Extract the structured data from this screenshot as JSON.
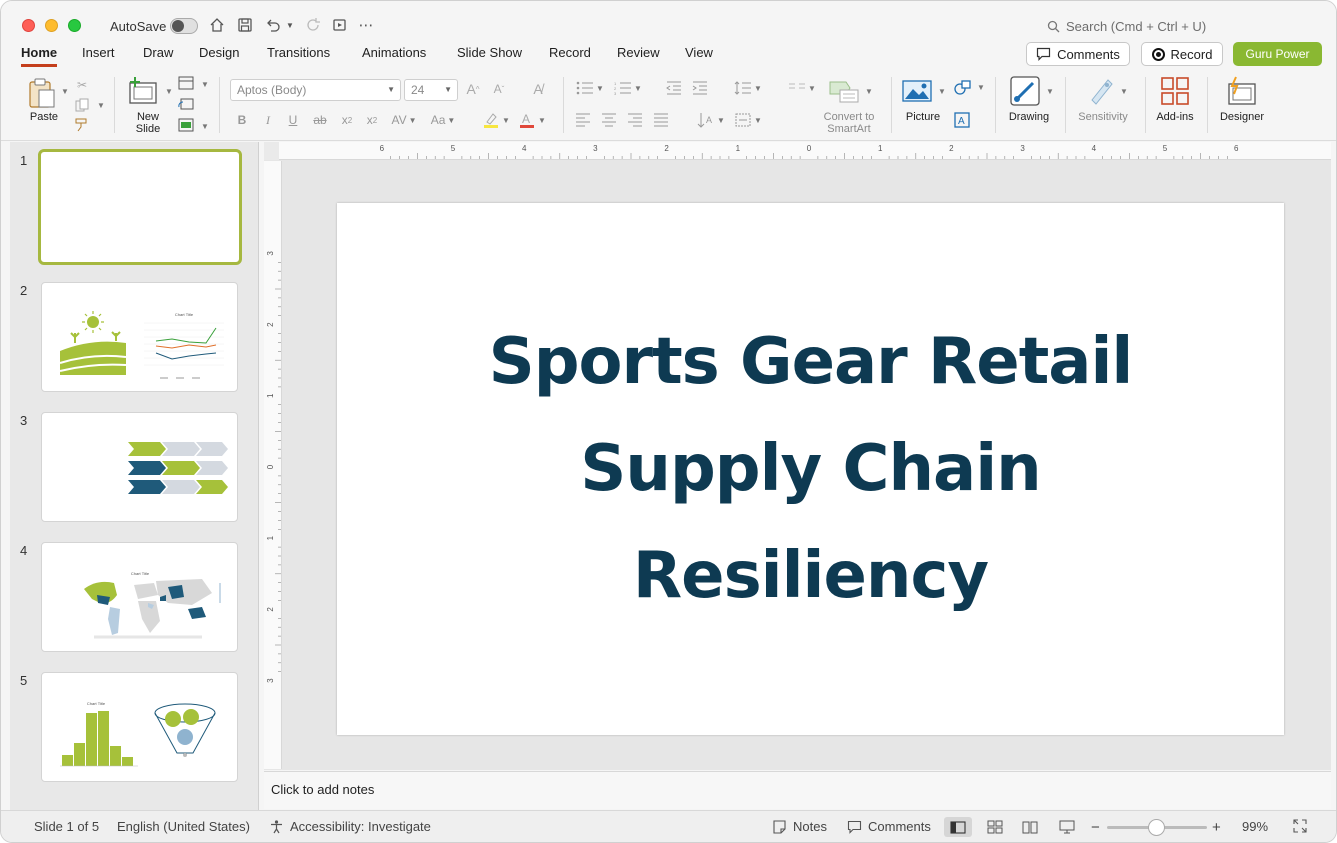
{
  "titlebar": {
    "autosave_label": "AutoSave",
    "search_placeholder": "Search (Cmd + Ctrl + U)"
  },
  "tabs": [
    {
      "label": "Home",
      "active": true
    },
    {
      "label": "Insert"
    },
    {
      "label": "Draw"
    },
    {
      "label": "Design"
    },
    {
      "label": "Transitions"
    },
    {
      "label": "Animations"
    },
    {
      "label": "Slide Show"
    },
    {
      "label": "Record"
    },
    {
      "label": "Review"
    },
    {
      "label": "View"
    }
  ],
  "top_buttons": {
    "comments": "Comments",
    "record": "Record",
    "guru": "Guru Power"
  },
  "ribbon": {
    "paste": "Paste",
    "new_slide_line1": "New",
    "new_slide_line2": "Slide",
    "font_name": "Aptos (Body)",
    "font_size": "24",
    "convert_line1": "Convert to",
    "convert_line2": "SmartArt",
    "picture": "Picture",
    "drawing": "Drawing",
    "sensitivity": "Sensitivity",
    "addins": "Add-ins",
    "designer": "Designer"
  },
  "slides": {
    "numbers": [
      "1",
      "2",
      "3",
      "4",
      "5"
    ],
    "thumb2_chart_title": "Chart Title",
    "thumb4_chart_title": "Chart Title",
    "thumb5_chart_title": "Chart Title"
  },
  "slide": {
    "title_line1": "Sports Gear Retail",
    "title_line2": "Supply Chain",
    "title_line3": "Resiliency",
    "title_color": "#0e3a52"
  },
  "ruler": {
    "h_labels": [
      "6",
      "5",
      "4",
      "3",
      "2",
      "1",
      "0",
      "1",
      "2",
      "3",
      "4",
      "5",
      "6"
    ],
    "v_labels": [
      "3",
      "2",
      "1",
      "0",
      "1",
      "2",
      "3"
    ]
  },
  "notes": {
    "placeholder": "Click to add notes"
  },
  "status": {
    "slide_of": "Slide 1 of 5",
    "language": "English (United States)",
    "accessibility": "Accessibility: Investigate",
    "notes": "Notes",
    "comments": "Comments",
    "zoom": "99%"
  },
  "colors": {
    "accent_tab": "#c43e1c",
    "guru_green": "#8ab832",
    "thumb_green": "#a6c13a",
    "thumb_blue": "#1f5a7a"
  }
}
